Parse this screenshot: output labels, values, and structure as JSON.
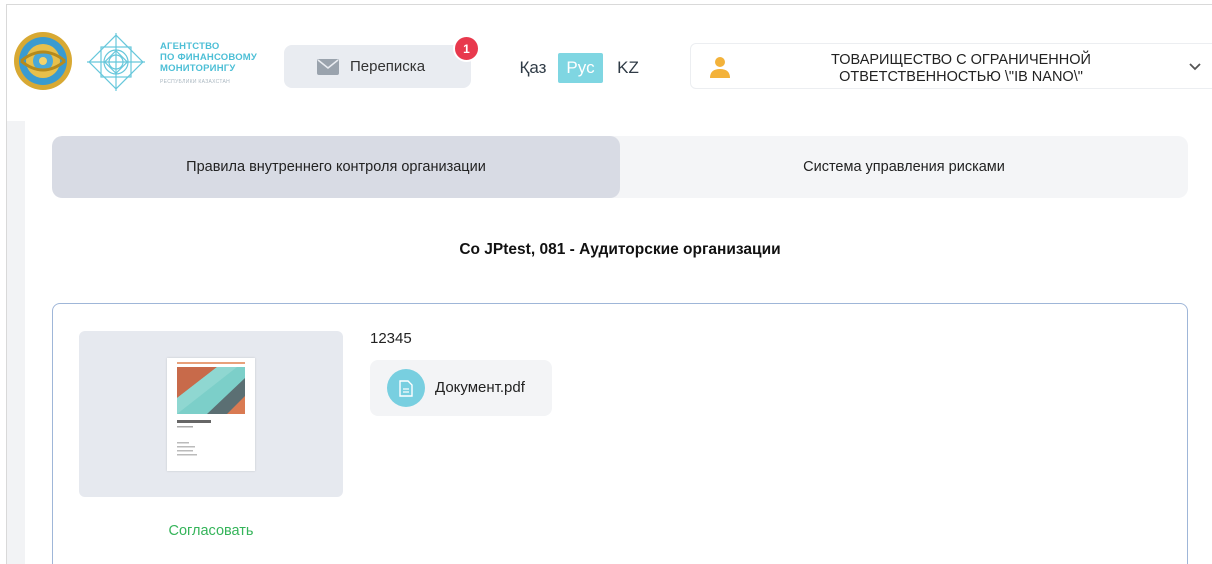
{
  "header": {
    "agency_lines": [
      "АГЕНТСТВО",
      "ПО ФИНАНСОВОМУ",
      "МОНИТОРИНГУ"
    ],
    "agency_sub": "РЕСПУБЛИКИ КАЗАХСТАН",
    "messages_label": "Переписка",
    "messages_count": "1",
    "languages": [
      "Қаз",
      "Рус",
      "KZ"
    ],
    "active_language": "Рус",
    "organization_line1": "ТОВАРИЩЕСТВО С ОГРАНИЧЕННОЙ",
    "organization_line2": "ОТВЕТСТВЕННОСТЬЮ \\\"IB NANO\\\""
  },
  "tabs": [
    {
      "label": "Правила внутреннего контроля организации",
      "active": true
    },
    {
      "label": "Система управления рисками",
      "active": false
    }
  ],
  "company_title": "Co JPtest, 081 - Аудиторские организации",
  "card": {
    "doc_number": "12345",
    "file_name": "Документ.pdf",
    "approve_label": "Согласовать"
  },
  "colors": {
    "accent": "#7fd6e2",
    "badge": "#e8394d",
    "approve": "#35b45a",
    "agency": "#4dbfd6"
  },
  "icons": {
    "messages": "envelope-icon",
    "user": "user-icon",
    "dropdown": "chevron-down-icon",
    "file": "file-icon"
  }
}
